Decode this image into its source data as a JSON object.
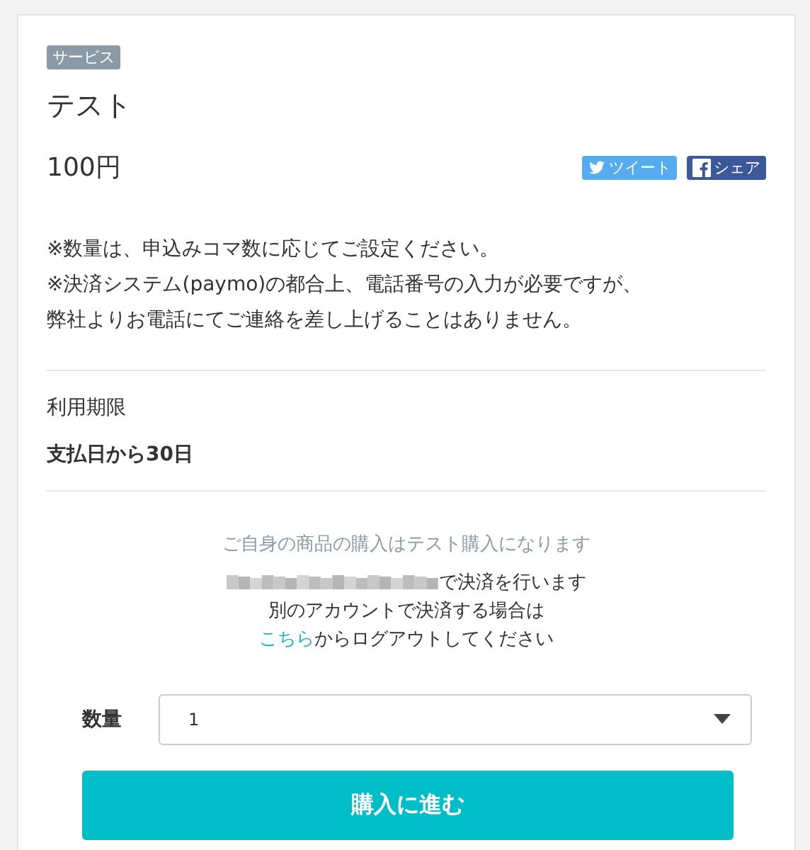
{
  "badge": "サービス",
  "title": "テスト",
  "price": "100円",
  "share_buttons": [
    {
      "kind": "twitter",
      "label": "ツイート"
    },
    {
      "kind": "facebook",
      "label": "シェア"
    }
  ],
  "notes": [
    "※数量は、申込みコマ数に応じてご設定ください。",
    "※決済システム(paymo)の都合上、電話番号の入力が必要ですが、",
    "弊社よりお電話にてご連絡を差し上げることはありません。"
  ],
  "validity": {
    "label": "利用期限",
    "value": "支払日から30日"
  },
  "purchase_notice": {
    "warning": "ご自身の商品の購入はテスト購入になります",
    "account_suffix": "で決済を行います",
    "switch_account": "別のアカウントで決済する場合は",
    "logout_link": "こちら",
    "logout_rest": "からログアウトしてください"
  },
  "quantity": {
    "label": "数量",
    "value": "1"
  },
  "submit_button": "購入に進む"
}
